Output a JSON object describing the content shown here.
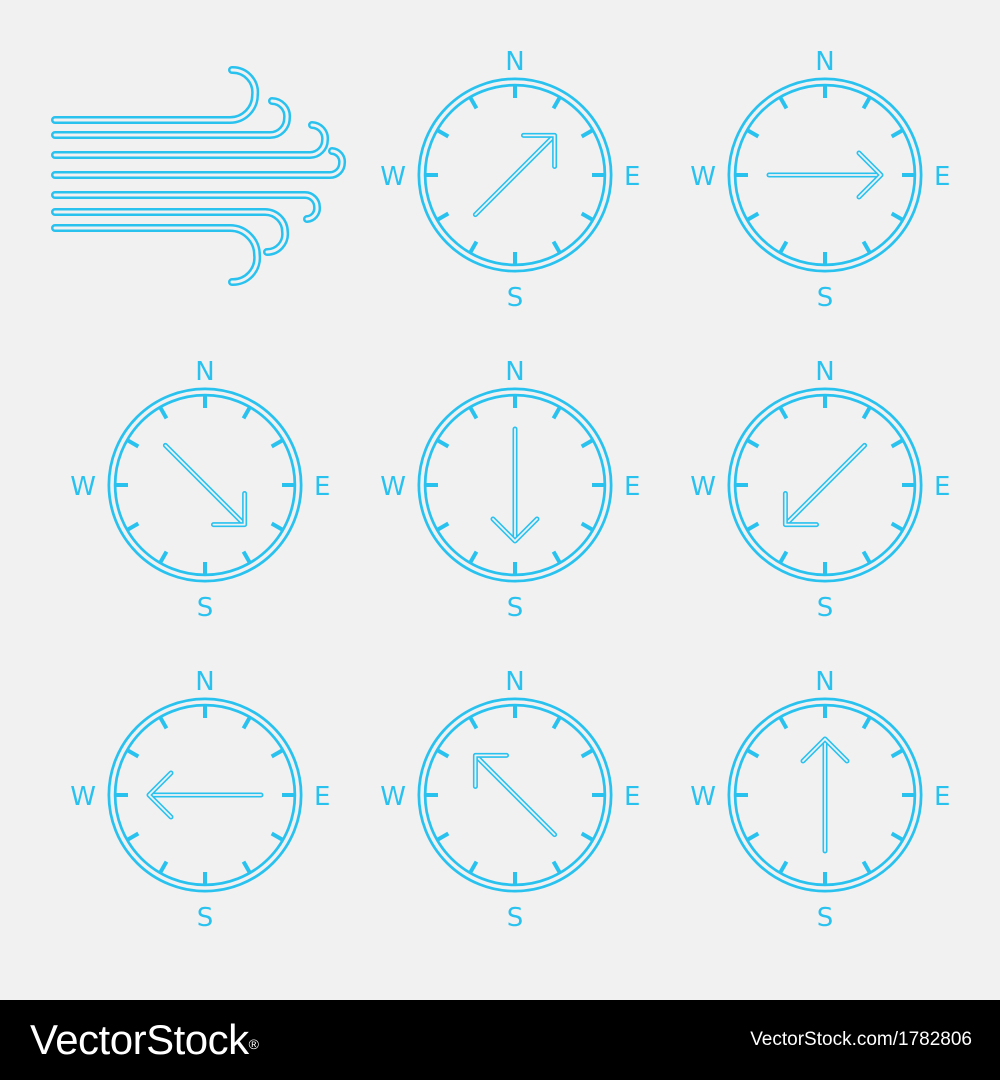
{
  "colors": {
    "background": "#f1f1f2",
    "icon_stroke": "#29c2ef",
    "icon_inner": "#f1f1f2",
    "footer_bg": "#000000",
    "footer_text": "#ffffff"
  },
  "wind_icon": {
    "name": "wind-icon"
  },
  "compass_labels": {
    "north": "N",
    "south": "S",
    "east": "E",
    "west": "W"
  },
  "compasses": [
    {
      "name": "compass-northeast",
      "arrow_direction": "northeast",
      "arrow_bearing_deg": 45
    },
    {
      "name": "compass-east",
      "arrow_direction": "east",
      "arrow_bearing_deg": 90
    },
    {
      "name": "compass-southeast",
      "arrow_direction": "southeast",
      "arrow_bearing_deg": 135
    },
    {
      "name": "compass-south",
      "arrow_direction": "south",
      "arrow_bearing_deg": 180
    },
    {
      "name": "compass-southwest",
      "arrow_direction": "southwest",
      "arrow_bearing_deg": 225
    },
    {
      "name": "compass-west",
      "arrow_direction": "west",
      "arrow_bearing_deg": 270
    },
    {
      "name": "compass-northwest",
      "arrow_direction": "northwest",
      "arrow_bearing_deg": 315
    },
    {
      "name": "compass-north",
      "arrow_direction": "north",
      "arrow_bearing_deg": 0
    }
  ],
  "footer": {
    "logo_text": "VectorStock",
    "logo_mark": "®",
    "credit": "VectorStock.com/1782806"
  }
}
